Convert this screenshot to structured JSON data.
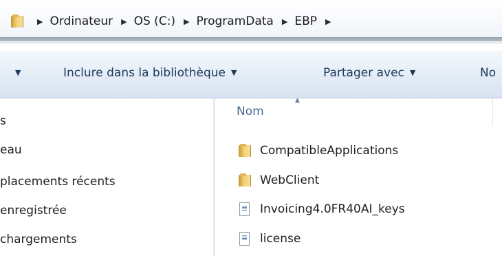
{
  "address": {
    "crumbs": [
      "Ordinateur",
      "OS (C:)",
      "ProgramData",
      "EBP"
    ]
  },
  "commands": {
    "include_library": "Inclure dans la bibliothèque",
    "share_with": "Partager avec",
    "new_partial": "No"
  },
  "navigation": {
    "items": [
      "s",
      "eau",
      "placements récents",
      "enregistrée",
      "chargements"
    ]
  },
  "columns": {
    "name": "Nom"
  },
  "files": [
    {
      "name": "CompatibleApplications",
      "icon": "folder-icon"
    },
    {
      "name": "WebClient",
      "icon": "folder-icon"
    },
    {
      "name": "Invoicing4.0FR40AI_keys",
      "icon": "file-icon"
    },
    {
      "name": "license",
      "icon": "file-icon"
    }
  ],
  "colors": {
    "command_text": "#1e395b",
    "column_header_text": "#4a6a96",
    "folder": "#f2d27a"
  }
}
